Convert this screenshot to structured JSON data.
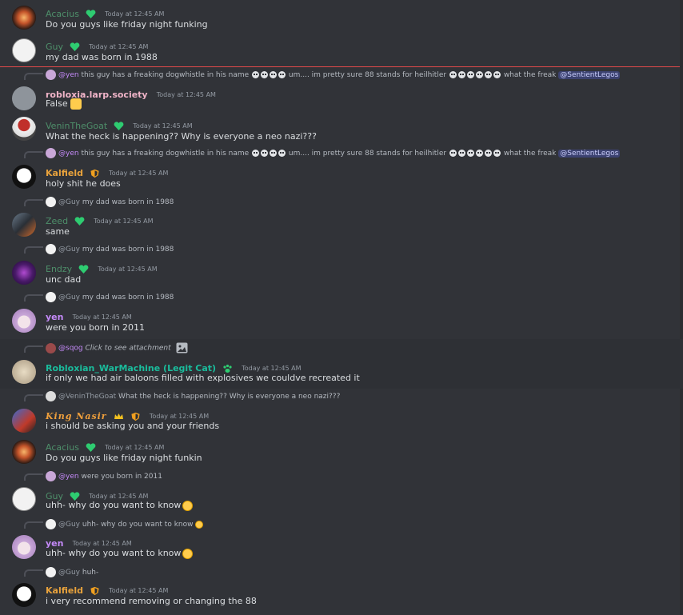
{
  "colors": {
    "green_name": "#4e8f6a",
    "purple_name": "#c58af9",
    "pink_name": "#f0b4c8",
    "orange_name": "#e8a23c",
    "teal_name": "#1abc9c",
    "gold_name": "#d4a23a",
    "mention_bg": "#3c4270"
  },
  "messages": [
    {
      "user": "Acacius",
      "time": "Today at 12:45 AM",
      "text": "Do you guys like friday night funking"
    },
    {
      "user": "Guy",
      "time": "Today at 12:45 AM",
      "text": "my dad was born in 1988"
    },
    {
      "reply": {
        "name": "@yen",
        "text": "this guy has a freaking dogwhistle in his name",
        "text2": "um.... im pretty sure 88 stands for heilhitler",
        "text3": "what the freak",
        "mention": "@SentientLegos"
      },
      "user": "robloxia.larp.society",
      "time": "Today at 12:45 AM",
      "text": "False"
    },
    {
      "user": "VeninTheGoat",
      "time": "Today at 12:45 AM",
      "text": "What the heck is happening?? Why is everyone a neo nazi???"
    },
    {
      "reply": {
        "name": "@yen",
        "text": "this guy has a freaking dogwhistle in his name",
        "text2": "um.... im pretty sure 88 stands for heilhitler",
        "text3": "what the freak",
        "mention": "@SentientLegos"
      },
      "user": "Kalfield",
      "time": "Today at 12:45 AM",
      "text": "holy shit he does"
    },
    {
      "reply": {
        "name": "@Guy",
        "text": "my dad was born in 1988"
      },
      "user": "Zeed",
      "time": "Today at 12:45 AM",
      "text": "same"
    },
    {
      "reply": {
        "name": "@Guy",
        "text": "my dad was born in 1988"
      },
      "user": "Endzy",
      "time": "Today at 12:45 AM",
      "text": "unc dad"
    },
    {
      "reply": {
        "name": "@Guy",
        "text": "my dad was born in 1988"
      },
      "user": "yen",
      "time": "Today at 12:45 AM",
      "text": "were you born in 2011"
    },
    {
      "reply": {
        "name": "@sqog",
        "text": "Click to see attachment"
      },
      "user": "Robloxian_WarMachine (Legit Cat)",
      "time": "Today at 12:45 AM",
      "text": "if only we had air baloons filled with explosives we couldve recreated it"
    },
    {
      "reply": {
        "name": "@VeninTheGoat",
        "text": "What the heck is happening?? Why is everyone a neo nazi???"
      },
      "user": "King Nasir",
      "time": "Today at 12:45 AM",
      "text": "i should be asking you and your friends"
    },
    {
      "user": "Acacius",
      "time": "Today at 12:45 AM",
      "text": "Do you guys like friday night funkin"
    },
    {
      "reply": {
        "name": "@yen",
        "text": "were you born in 2011"
      },
      "user": "Guy",
      "time": "Today at 12:45 AM",
      "text": "uhh- why do you want to know"
    },
    {
      "reply": {
        "name": "@Guy",
        "text": "uhh- why do you want to know"
      },
      "user": "yen",
      "time": "Today at 12:45 AM",
      "text": "uhh- why do you want to know"
    },
    {
      "reply": {
        "name": "@Guy",
        "text": "huh-"
      },
      "user": "Kalfield",
      "time": "Today at 12:45 AM",
      "text": "i very recommend removing or changing the 88"
    }
  ]
}
